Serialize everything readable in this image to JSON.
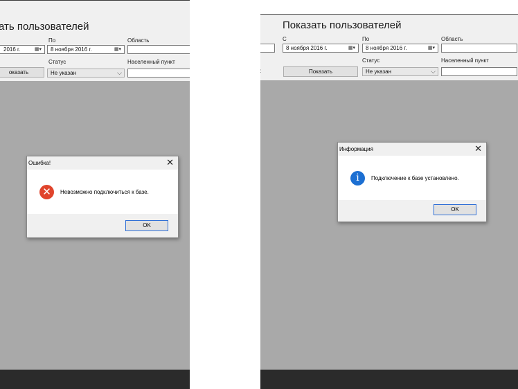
{
  "left_window": {
    "title": "ать пользователей",
    "labels": {
      "to": "По",
      "region": "Область",
      "status": "Статус",
      "locality": "Населенный пункт"
    },
    "date_from_value": "2016 г.",
    "date_to_value": "8  ноября   2016 г.",
    "status_value": "Не указан",
    "show_button": "оказать",
    "region_value": "",
    "locality_value": ""
  },
  "right_window": {
    "title": "Показать пользователей",
    "labels": {
      "from": "С",
      "to": "По",
      "region": "Область",
      "status": "Статус",
      "locality": "Населенный пункт"
    },
    "left_fragment": ":",
    "date_from_value": "8  ноября   2016 г.",
    "date_to_value": "8  ноября   2016 г.",
    "status_value": "Не указан",
    "show_button": "Показать",
    "region_value": "",
    "locality_value": ""
  },
  "dialog_error": {
    "title": "Ошибка!",
    "close_glyph": "✕",
    "icon_glyph": "✕",
    "icon_color": "#e0442c",
    "message": "Невозможно подключиться к базе.",
    "ok": "OK"
  },
  "dialog_info": {
    "title": "Информация",
    "close_glyph": "✕",
    "icon_glyph": "i",
    "icon_color": "#1c6fd2",
    "message": "Подключение к базе установлено.",
    "ok": "OK"
  },
  "icons": {
    "calendar_dropdown": "▦▾",
    "combo_arrow": "⌵"
  }
}
